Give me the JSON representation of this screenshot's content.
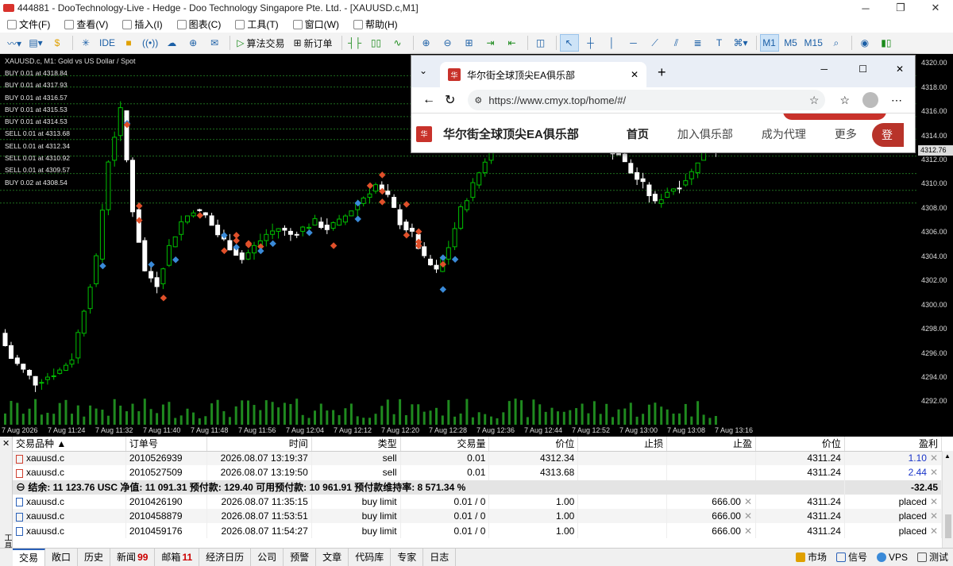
{
  "titlebar": {
    "title": "444881 - DooTechnology-Live - Hedge - Doo Technology Singapore Pte. Ltd. - [XAUUSD.c,M1]",
    "minimize": "─",
    "restore": "❐",
    "close": "✕"
  },
  "menu": [
    "文件(F)",
    "查看(V)",
    "插入(I)",
    "图表(C)",
    "工具(T)",
    "窗口(W)",
    "帮助(H)"
  ],
  "toolbar": {
    "algo_label": "算法交易",
    "new_order_label": "新订单",
    "ide_label": "IDE",
    "tf_m1": "M1",
    "tf_m5": "M5",
    "tf_m15": "M15"
  },
  "chart": {
    "symbol_line": "XAUUSD.c, M1:  Gold vs US Dollar / Spot",
    "order_labels": [
      "BUY 0.01 at 4318.84",
      "BUY 0.01 at 4317.93",
      "BUY 0.01 at 4316.57",
      "BUY 0.01 at 4315.53",
      "BUY 0.01 at 4314.53",
      "SELL 0.01 at 4313.68",
      "SELL 0.01 at 4312.34",
      "SELL 0.01 at 4310.92",
      "SELL 0.01 at 4309.57",
      "BUY 0.02 at 4308.54"
    ],
    "price_ticks": [
      "4320.00",
      "4318.00",
      "4316.00",
      "4314.00",
      "4312.00",
      "4310.00",
      "4308.00",
      "4306.00",
      "4304.00",
      "4302.00",
      "4300.00",
      "4298.00",
      "4296.00",
      "4294.00",
      "4292.00"
    ],
    "current_price": "4312.76",
    "time_ticks": [
      "7 Aug 2026",
      "7 Aug 11:24",
      "7 Aug 11:32",
      "7 Aug 11:40",
      "7 Aug 11:48",
      "7 Aug 11:56",
      "7 Aug 12:04",
      "7 Aug 12:12",
      "7 Aug 12:20",
      "7 Aug 12:28",
      "7 Aug 12:36",
      "7 Aug 12:44",
      "7 Aug 12:52",
      "7 Aug 13:00",
      "7 Aug 13:08",
      "7 Aug 13:16"
    ],
    "colors": {
      "up": "#00c000",
      "down": "#ffffff",
      "grid_level": "#1e6e1e",
      "sell_marker": "#e0502a",
      "buy_marker": "#3a8ad8"
    }
  },
  "browser": {
    "tab_title": "华尔街全球顶尖EA俱乐部",
    "url": "https://www.cmyx.top/home/#/",
    "site_brand": "华尔街全球顶尖EA俱乐部",
    "nav": [
      "首页",
      "加入俱乐部",
      "成为代理",
      "更多"
    ],
    "button_text": "登"
  },
  "trade": {
    "columns": [
      "交易品种",
      "订单号",
      "时间",
      "类型",
      "交易量",
      "价位",
      "止损",
      "止盈",
      "价位",
      "盈利"
    ],
    "positions": [
      {
        "symbol": "xauusd.c",
        "ticket": "2010526939",
        "time": "2026.08.07 13:19:37",
        "type": "sell",
        "volume": "0.01",
        "price": "4312.34",
        "sl": "",
        "tp": "",
        "cur": "4311.24",
        "profit": "1.10"
      },
      {
        "symbol": "xauusd.c",
        "ticket": "2010527509",
        "time": "2026.08.07 13:19:50",
        "type": "sell",
        "volume": "0.01",
        "price": "4313.68",
        "sl": "",
        "tp": "",
        "cur": "4311.24",
        "profit": "2.44"
      }
    ],
    "summary": "结余: 11 123.76 USC  净值: 11 091.31  预付款: 129.40  可用预付款: 10 961.91  预付款维持率: 8 571.34 %",
    "summary_profit": "-32.45",
    "orders": [
      {
        "symbol": "xauusd.c",
        "ticket": "2010426190",
        "time": "2026.08.07 11:35:15",
        "type": "buy limit",
        "volume": "0.01 / 0",
        "price": "1.00",
        "sl": "",
        "tp": "666.00",
        "cur": "4311.24",
        "profit": "placed"
      },
      {
        "symbol": "xauusd.c",
        "ticket": "2010458879",
        "time": "2026.08.07 11:53:51",
        "type": "buy limit",
        "volume": "0.01 / 0",
        "price": "1.00",
        "sl": "",
        "tp": "666.00",
        "cur": "4311.24",
        "profit": "placed"
      },
      {
        "symbol": "xauusd.c",
        "ticket": "2010459176",
        "time": "2026.08.07 11:54:27",
        "type": "buy limit",
        "volume": "0.01 / 0",
        "price": "1.00",
        "sl": "",
        "tp": "666.00",
        "cur": "4311.24",
        "profit": "placed"
      }
    ]
  },
  "bottom_tabs": [
    {
      "label": "交易",
      "badge": ""
    },
    {
      "label": "敞口",
      "badge": ""
    },
    {
      "label": "历史",
      "badge": ""
    },
    {
      "label": "新闻",
      "badge": "99"
    },
    {
      "label": "邮箱",
      "badge": "11"
    },
    {
      "label": "经济日历",
      "badge": ""
    },
    {
      "label": "公司",
      "badge": ""
    },
    {
      "label": "预警",
      "badge": ""
    },
    {
      "label": "文章",
      "badge": ""
    },
    {
      "label": "代码库",
      "badge": ""
    },
    {
      "label": "专家",
      "badge": ""
    },
    {
      "label": "日志",
      "badge": ""
    }
  ],
  "status_right": {
    "market": "市场",
    "signals": "信号",
    "vps": "VPS",
    "tester": "测试"
  },
  "side_label": "工具箱"
}
